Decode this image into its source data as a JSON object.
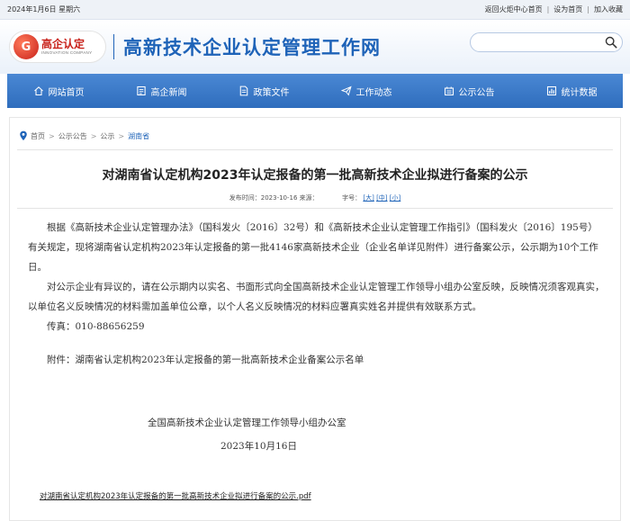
{
  "topbar": {
    "date": "2024年1月6日 星期六",
    "links": [
      "返回火炬中心首页",
      "设为首页",
      "加入收藏"
    ]
  },
  "header": {
    "logo_cn": "高企认定",
    "logo_en": "INNOVATION COMPANY",
    "site_title": "高新技术企业认定管理工作网",
    "search_placeholder": ""
  },
  "nav": {
    "items": [
      {
        "label": "网站首页",
        "icon": "home-icon"
      },
      {
        "label": "高企新闻",
        "icon": "news-icon"
      },
      {
        "label": "政策文件",
        "icon": "document-icon"
      },
      {
        "label": "工作动态",
        "icon": "paper-plane-icon"
      },
      {
        "label": "公示公告",
        "icon": "notice-icon"
      },
      {
        "label": "统计数据",
        "icon": "chart-icon"
      }
    ]
  },
  "breadcrumb": [
    "首页",
    "公示公告",
    "公示",
    "湖南省"
  ],
  "article": {
    "title": "对湖南省认定机构2023年认定报备的第一批高新技术企业拟进行备案的公示",
    "publish_label": "发布时间：2023-10-16",
    "source_label": "来源：",
    "font_label": "字号：",
    "font_sizes": [
      "[大]",
      "[中]",
      "[小]"
    ],
    "para1": "根据《高新技术企业认定管理办法》（国科发火〔2016〕32号）和《高新技术企业认定管理工作指引》（国科发火〔2016〕195号）有关规定，现将湖南省认定机构2023年认定报备的第一批4146家高新技术企业（企业名单详见附件）进行备案公示，公示期为10个工作日。",
    "para2": "对公示企业有异议的，请在公示期内以实名、书面形式向全国高新技术企业认定管理工作领导小组办公室反映，反映情况须客观真实，以单位名义反映情况的材料需加盖单位公章，以个人名义反映情况的材料应署真实姓名并提供有效联系方式。",
    "fax": "传真：010-88656259",
    "attachment": "附件：湖南省认定机构2023年认定报备的第一批高新技术企业备案公示名单",
    "signature": "全国高新技术企业认定管理工作领导小组办公室",
    "sign_date": "2023年10月16日",
    "pdf_link": "对湖南省认定机构2023年认定报备的第一批高新技术企业拟进行备案的公示.pdf"
  }
}
